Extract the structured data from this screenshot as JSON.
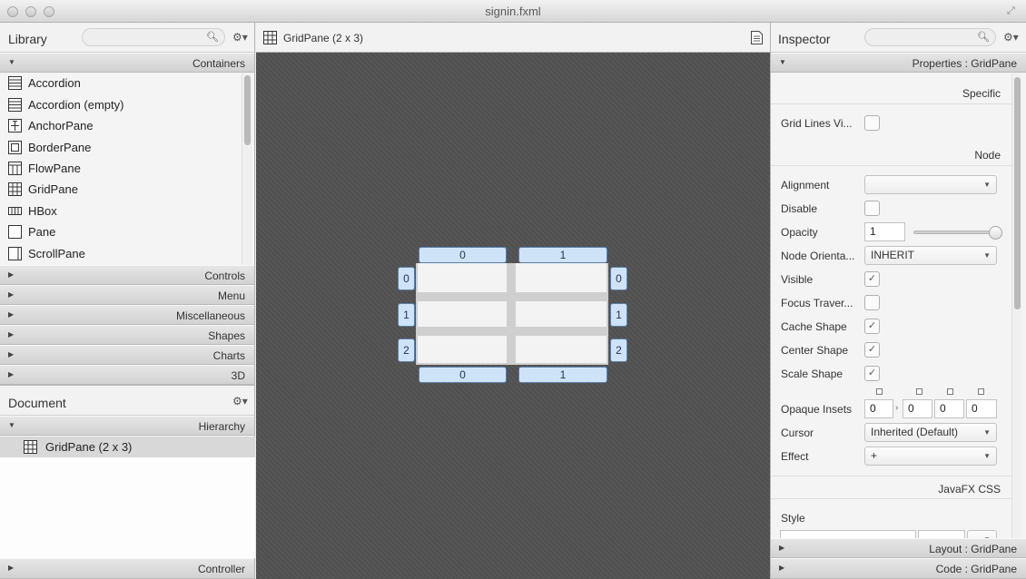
{
  "window": {
    "title": "signin.fxml"
  },
  "library": {
    "title": "Library",
    "search_placeholder": "",
    "containers_label": "Containers",
    "items": [
      {
        "label": "Accordion",
        "icon": "accordion-icon"
      },
      {
        "label": "Accordion  (empty)",
        "icon": "accordion-empty-icon"
      },
      {
        "label": "AnchorPane",
        "icon": "anchorpane-icon"
      },
      {
        "label": "BorderPane",
        "icon": "borderpane-icon"
      },
      {
        "label": "FlowPane",
        "icon": "flowpane-icon"
      },
      {
        "label": "GridPane",
        "icon": "gridpane-icon"
      },
      {
        "label": "HBox",
        "icon": "hbox-icon"
      },
      {
        "label": "Pane",
        "icon": "pane-icon"
      },
      {
        "label": "ScrollPane",
        "icon": "scrollpane-icon"
      }
    ],
    "sections": [
      "Controls",
      "Menu",
      "Miscellaneous",
      "Shapes",
      "Charts",
      "3D"
    ]
  },
  "document": {
    "title": "Document",
    "hierarchy_label": "Hierarchy",
    "node_label": "GridPane (2 x 3)",
    "controller_label": "Controller"
  },
  "canvas": {
    "breadcrumb": "GridPane (2 x 3)",
    "col_labels": [
      "0",
      "1"
    ],
    "row_labels": [
      "0",
      "1",
      "2"
    ]
  },
  "inspector": {
    "title": "Inspector",
    "properties_label": "Properties : GridPane",
    "specific_label": "Specific",
    "grid_lines_label": "Grid Lines Vi...",
    "node_label": "Node",
    "alignment_label": "Alignment",
    "alignment_value": "",
    "disable_label": "Disable",
    "opacity_label": "Opacity",
    "opacity_value": "1",
    "opacity_level": 1.0,
    "node_orientation_label": "Node Orienta...",
    "node_orientation_value": "INHERIT",
    "visible_label": "Visible",
    "focus_traversable_label": "Focus Traver...",
    "cache_shape_label": "Cache Shape",
    "center_shape_label": "Center Shape",
    "scale_shape_label": "Scale Shape",
    "opaque_insets_label": "Opaque Insets",
    "opaque_insets": [
      "0",
      "0",
      "0",
      "0"
    ],
    "cursor_label": "Cursor",
    "cursor_value": "Inherited (Default)",
    "effect_label": "Effect",
    "effect_value": "+",
    "javafx_css_label": "JavaFX CSS",
    "style_label": "Style",
    "layout_label": "Layout : GridPane",
    "code_label": "Code : GridPane"
  },
  "colors": {
    "accent": "#cfe3f8",
    "canvas_bg": "#525252"
  }
}
